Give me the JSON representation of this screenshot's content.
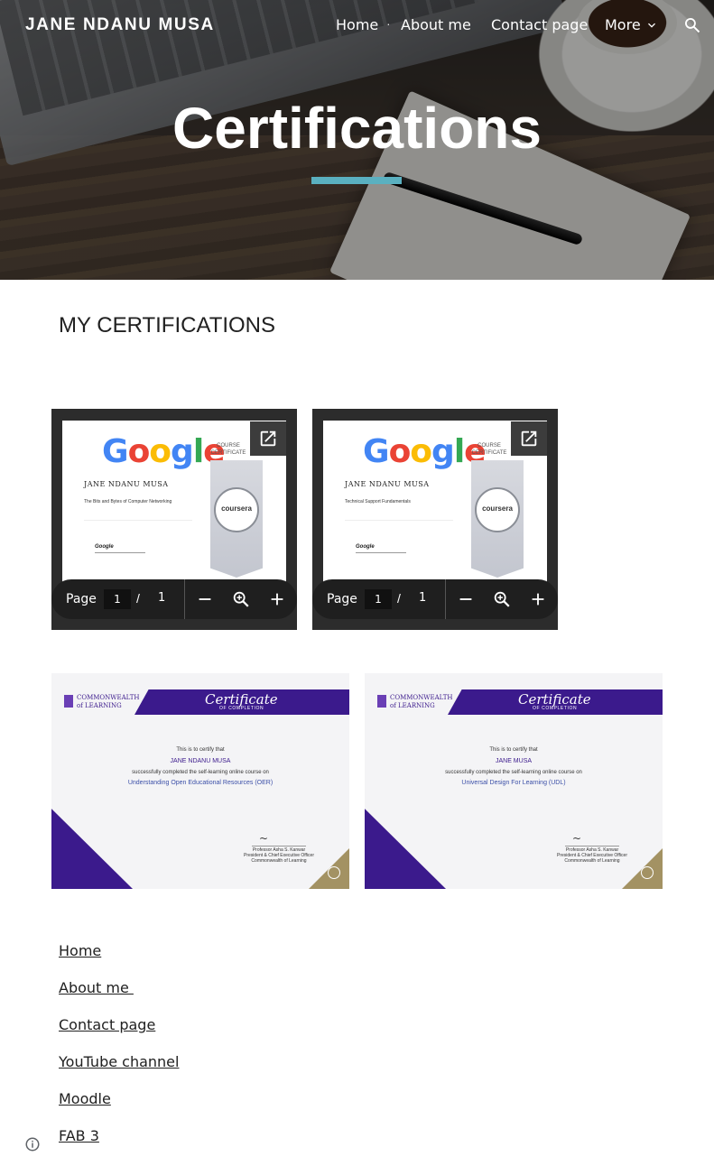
{
  "header": {
    "site_title": "JANE NDANU MUSA",
    "nav": {
      "home": "Home",
      "separator": "·",
      "about": "About me",
      "contact": "Contact page",
      "more": "More"
    }
  },
  "hero": {
    "title": "Certifications",
    "accent_color": "#5ab0c0"
  },
  "main": {
    "heading": "MY CERTIFICATIONS",
    "pdf_viewers": [
      {
        "logo": [
          "G",
          "o",
          "o",
          "g",
          "l",
          "e"
        ],
        "course_certificate": "COURSE CERTIFICATE",
        "name": "JANE NDANU MUSA",
        "course": "The Bits and Bytes of Computer Networking",
        "seal": "coursera",
        "signature": "Google",
        "toolbar": {
          "page_label": "Page",
          "current_page": "1",
          "separator": "/",
          "total_pages": "1"
        }
      },
      {
        "logo": [
          "G",
          "o",
          "o",
          "g",
          "l",
          "e"
        ],
        "course_certificate": "COURSE CERTIFICATE",
        "name": "JANE NDANU MUSA",
        "course": "Technical Support Fundamentals",
        "seal": "coursera",
        "signature": "Google",
        "toolbar": {
          "page_label": "Page",
          "current_page": "1",
          "separator": "/",
          "total_pages": "1"
        }
      }
    ],
    "col_certificates": [
      {
        "org": "COMMONWEALTH of LEARNING",
        "title": "Certificate",
        "subtitle": "OF COMPLETION",
        "certify": "This is to certify that",
        "name": "JANE NDANU MUSA",
        "completed": "successfully completed the self-learning online course on",
        "course": "Understanding Open Educational Resources (OER)",
        "signer": "Professor Asha S. Kanwar",
        "signer_title": "President & Chief Executive Officer",
        "signer_org": "Commonwealth of Learning"
      },
      {
        "org": "COMMONWEALTH of LEARNING",
        "title": "Certificate",
        "subtitle": "OF COMPLETION",
        "certify": "This is to certify that",
        "name": "JANE MUSA",
        "completed": "successfully completed the self-learning online course on",
        "course": "Universal Design For Learning (UDL)",
        "signer": "Professor Asha S. Kanwar",
        "signer_title": "President & Chief Executive Officer",
        "signer_org": "Commonwealth of Learning"
      }
    ]
  },
  "footer": {
    "links": [
      "Home",
      "About me ",
      "Contact page",
      "YouTube channel",
      "Moodle",
      "FAB 3"
    ]
  },
  "icons": {
    "more": "chevron-down-icon",
    "search": "search-icon",
    "open_in_new": "open-in-new-icon",
    "zoom_out": "minus-icon",
    "zoom": "zoom-icon",
    "zoom_in": "plus-icon",
    "info": "info-icon"
  }
}
